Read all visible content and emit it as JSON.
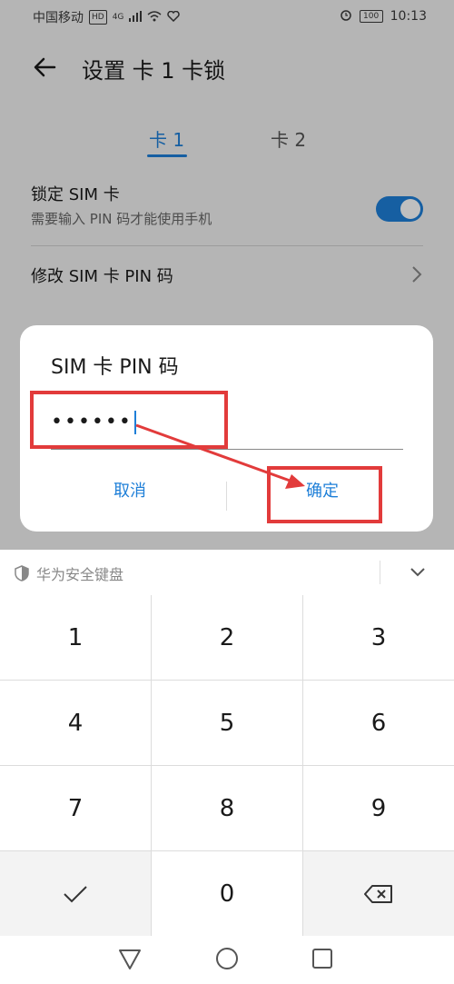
{
  "status_bar": {
    "carrier": "中国移动",
    "hd": "HD",
    "network": "4G",
    "battery": "100",
    "time": "10:13"
  },
  "header": {
    "title": "设置 卡 1 卡锁"
  },
  "tabs": [
    {
      "label": "卡 1",
      "selected": true
    },
    {
      "label": "卡 2",
      "selected": false
    }
  ],
  "settings": {
    "lock_sim": {
      "title": "锁定 SIM 卡",
      "subtitle": "需要输入 PIN 码才能使用手机",
      "enabled": true
    },
    "change_pin": {
      "title": "修改 SIM 卡 PIN 码"
    }
  },
  "dialog": {
    "title": "SIM 卡 PIN 码",
    "pin_value": "••••••",
    "cancel_label": "取消",
    "ok_label": "确定"
  },
  "keyboard": {
    "brand": "华为安全键盘",
    "keys": [
      "1",
      "2",
      "3",
      "4",
      "5",
      "6",
      "7",
      "8",
      "9",
      "✓",
      "0",
      "⌫"
    ]
  },
  "colors": {
    "accent": "#1e7fd8",
    "highlight": "#e23b3b"
  }
}
